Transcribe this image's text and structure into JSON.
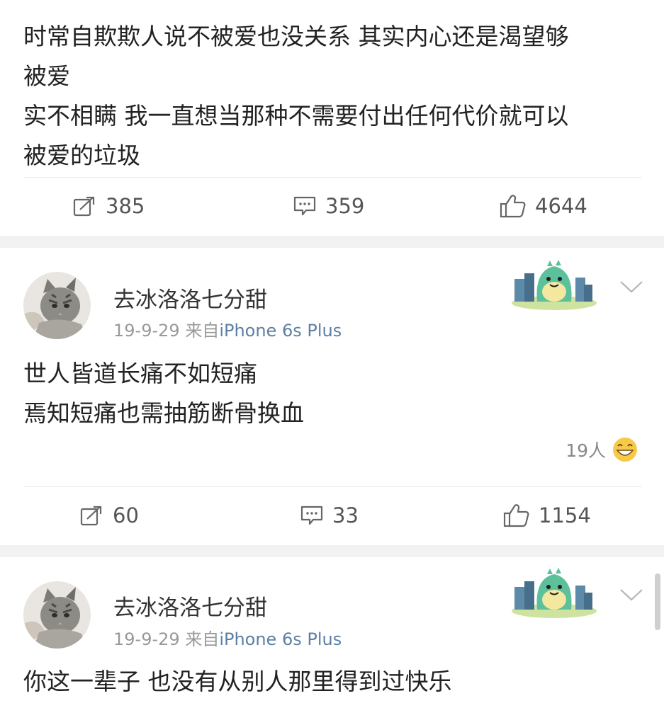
{
  "posts": [
    {
      "text_lines": [
        "时常自欺欺人说不被爱也没关系 其实内心还是渴望够",
        "被爱",
        "实不相瞒 我一直想当那种不需要付出任何代价就可以",
        "被爱的垃圾"
      ],
      "repost_count": "385",
      "comment_count": "359",
      "like_count": "4644"
    },
    {
      "username": "去冰洛洛七分甜",
      "date": "19-9-29",
      "source_prefix": "来自",
      "source_device": "iPhone 6s Plus",
      "text_lines": [
        "世人皆道长痛不如短痛",
        "焉知短痛也需抽筋断骨换血"
      ],
      "reaction_count": "19人",
      "repost_count": "60",
      "comment_count": "33",
      "like_count": "1154"
    },
    {
      "username": "去冰洛洛七分甜",
      "date": "19-9-29",
      "source_prefix": "来自",
      "source_device": "iPhone 6s Plus",
      "text_lines": [
        "你这一辈子 也没有从别人那里得到过快乐"
      ]
    }
  ],
  "icons": {
    "repost": "repost-icon",
    "comment": "comment-icon",
    "like": "thumbs-up-icon",
    "badge": "dinosaur-sticker-icon",
    "more": "chevron-down-icon",
    "reaction": "laughing-emoji-icon"
  },
  "colors": {
    "source_link": "#5d7fa3",
    "meta": "#999999",
    "divider": "#ececec",
    "background": "#f2f2f2"
  }
}
